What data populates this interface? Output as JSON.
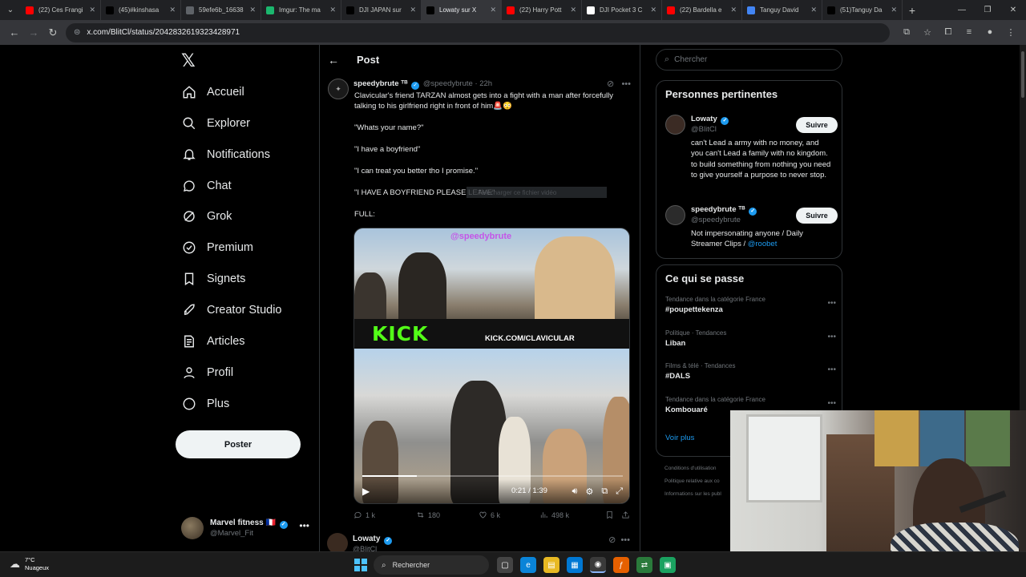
{
  "browser": {
    "tabs": [
      {
        "title": "(22) Ces Frangi",
        "favicon": "youtube-icon",
        "color": "#ff0000"
      },
      {
        "title": "(45)#kinshasa",
        "favicon": "tiktok-icon",
        "color": "#000000"
      },
      {
        "title": "59efe6b_16638",
        "favicon": "globe-icon",
        "color": "#5f6368"
      },
      {
        "title": "Imgur: The ma",
        "favicon": "imgur-icon",
        "color": "#1bb76e"
      },
      {
        "title": "DJI JAPAN sur",
        "favicon": "x-icon",
        "color": "#000000"
      },
      {
        "title": "Lowaty sur X",
        "favicon": "x-icon",
        "color": "#000000"
      },
      {
        "title": "(22) Harry Pott",
        "favicon": "youtube-icon",
        "color": "#ff0000"
      },
      {
        "title": "DJI Pocket 3 C",
        "favicon": "bookmark-icon",
        "color": "#ffffff"
      },
      {
        "title": "(22) Bardella e",
        "favicon": "youtube-icon",
        "color": "#ff0000"
      },
      {
        "title": "Tanguy David",
        "favicon": "google-icon",
        "color": "#4285f4"
      },
      {
        "title": "(51)Tanguy Da",
        "favicon": "tiktok-icon",
        "color": "#000000"
      }
    ],
    "active_tab": 5,
    "url": "x.com/BlitCl/status/2042832619323428971"
  },
  "nav": {
    "items": [
      {
        "label": "Accueil",
        "icon": "home-icon"
      },
      {
        "label": "Explorer",
        "icon": "search-icon"
      },
      {
        "label": "Notifications",
        "icon": "bell-icon"
      },
      {
        "label": "Chat",
        "icon": "chat-icon"
      },
      {
        "label": "Grok",
        "icon": "grok-icon"
      },
      {
        "label": "Premium",
        "icon": "premium-icon"
      },
      {
        "label": "Signets",
        "icon": "bookmark-icon"
      },
      {
        "label": "Creator Studio",
        "icon": "rocket-icon"
      },
      {
        "label": "Articles",
        "icon": "articles-icon"
      },
      {
        "label": "Profil",
        "icon": "person-icon"
      },
      {
        "label": "Plus",
        "icon": "more-circle-icon"
      }
    ],
    "post_button": "Poster",
    "account": {
      "name": "Marvel fitness",
      "flag": "🇫🇷",
      "handle": "@Marvel_Fit"
    }
  },
  "main": {
    "header": "Post",
    "tweet": {
      "author_name": "speedybrute",
      "author_suffix": "ᵀᴮ",
      "handle": "@speedybrute",
      "time": "· 22h",
      "text_lines": [
        "Clavicular's friend TARZAN almost gets into a fight with a man after forcefully talking to his girlfriend right in front of him🚨😳",
        "\"Whats your name?\"",
        "\"I have a boyfriend\"",
        "\"I can treat you better tho I promise.\"",
        "\"I HAVE A BOYFRIEND PLEASE LEAVE\"",
        "FULL:"
      ],
      "download_overlay": "Télécharger ce fichier vidéo",
      "video": {
        "watermark": "@speedybrute",
        "kick_logo": "KICK",
        "kick_url": "KICK.COM/CLAVICULAR",
        "time": "0:21 / 1:39",
        "progress": 0.21
      },
      "stats": {
        "replies": "1 k",
        "reposts": "180",
        "likes": "6 k",
        "views": "498 k"
      }
    },
    "next_tweet": {
      "name": "Lowaty",
      "handle": "@BlitCl"
    }
  },
  "right": {
    "search_placeholder": "Chercher",
    "relevant": {
      "title": "Personnes pertinentes",
      "people": [
        {
          "name": "Lowaty",
          "handle": "@BlitCl",
          "follow": "Suivre",
          "bio": "can't Lead a army with no money, and you can't Lead a family with no kingdom. to build something from nothing you need to give yourself a purpose to never stop.",
          "bio_link": ""
        },
        {
          "name": "speedybrute",
          "name_suffix": "ᵀᴮ",
          "handle": "@speedybrute",
          "follow": "Suivre",
          "bio": "Not impersonating anyone / Daily Streamer Clips / ",
          "bio_link": "@roobet"
        }
      ]
    },
    "happening": {
      "title": "Ce qui se passe",
      "trends": [
        {
          "context": "Tendance dans la catégorie France",
          "name": "#poupettekenza"
        },
        {
          "context": "Politique · Tendances",
          "name": "Liban"
        },
        {
          "context": "Films & télé · Tendances",
          "name": "#DALS"
        },
        {
          "context": "Tendance dans la catégorie France",
          "name": "Kombouaré"
        }
      ],
      "see_more": "Voir plus"
    },
    "footer": [
      "Conditions d'utilisation",
      "Politique relative aux co",
      "Informations sur les publ"
    ]
  },
  "taskbar": {
    "weather_temp": "7°C",
    "weather_desc": "Nuageux",
    "search": "Rechercher"
  }
}
